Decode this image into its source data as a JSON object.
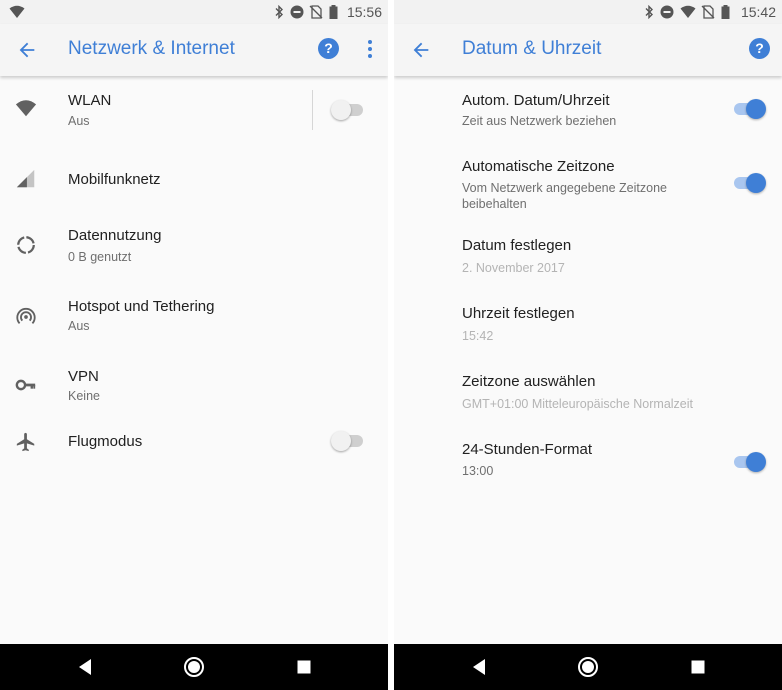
{
  "left": {
    "status": {
      "time": "15:56"
    },
    "appbar": {
      "title": "Netzwerk & Internet"
    },
    "items": [
      {
        "title": "WLAN",
        "subtitle": "Aus",
        "icon": "wifi-icon",
        "toggle": false
      },
      {
        "title": "Mobilfunknetz",
        "icon": "signal-icon"
      },
      {
        "title": "Datennutzung",
        "subtitle": "0 B genutzt",
        "icon": "data-usage-icon"
      },
      {
        "title": "Hotspot und Tethering",
        "subtitle": "Aus",
        "icon": "hotspot-icon"
      },
      {
        "title": "VPN",
        "subtitle": "Keine",
        "icon": "key-icon"
      },
      {
        "title": "Flugmodus",
        "icon": "airplane-icon",
        "toggle": false
      }
    ]
  },
  "right": {
    "status": {
      "time": "15:42"
    },
    "appbar": {
      "title": "Datum & Uhrzeit"
    },
    "items": [
      {
        "title": "Autom. Datum/Uhrzeit",
        "subtitle": "Zeit aus Netzwerk beziehen",
        "toggle": true
      },
      {
        "title": "Automatische Zeitzone",
        "subtitle_line1": "Vom Netzwerk angegebene Zeitzone",
        "subtitle_line2": "beibehalten",
        "toggle": true
      },
      {
        "title": "Datum festlegen",
        "subtitle": "2. November 2017",
        "disabled": true
      },
      {
        "title": "Uhrzeit festlegen",
        "subtitle": "15:42",
        "disabled": true
      },
      {
        "title": "Zeitzone auswählen",
        "subtitle": "GMT+01:00 Mitteleuropäische Normalzeit",
        "disabled": true
      },
      {
        "title": "24-Stunden-Format",
        "subtitle": "13:00",
        "toggle": true
      }
    ]
  },
  "colors": {
    "accent": "#3f7fd6",
    "disabled_text": "#b4b4b4",
    "navbar": "#000000"
  },
  "icons": [
    "back-arrow-icon",
    "help-icon",
    "more-vert-icon",
    "bluetooth-icon",
    "dnd-icon",
    "no-sim-icon",
    "wifi-status-icon",
    "battery-icon",
    "nav-back-icon",
    "nav-home-icon",
    "nav-recents-icon"
  ]
}
